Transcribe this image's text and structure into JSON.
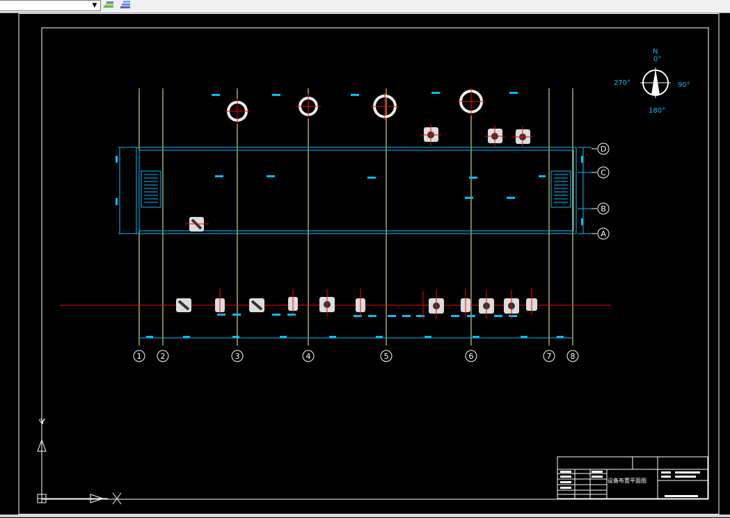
{
  "toolbar": {
    "layer_combo_value": "",
    "buttons": [
      "layer-states-icon",
      "layer-properties-icon"
    ]
  },
  "compass": {
    "north_letter": "N",
    "deg_0": "0°",
    "deg_90": "90°",
    "deg_180": "180°",
    "deg_270": "270°"
  },
  "grid_columns": [
    "1",
    "2",
    "3",
    "4",
    "5",
    "6",
    "7",
    "8"
  ],
  "grid_rows": [
    "D",
    "C",
    "B",
    "A"
  ],
  "ucs": {
    "y_label": "Y"
  },
  "title_block": {
    "drawing_name": "设备布置平面图"
  },
  "colors": {
    "background": "#000000",
    "grid_line": "#ffff80",
    "dimension": "#00c0ff",
    "centerline": "#ff0000",
    "equipment": "#ffffff"
  }
}
